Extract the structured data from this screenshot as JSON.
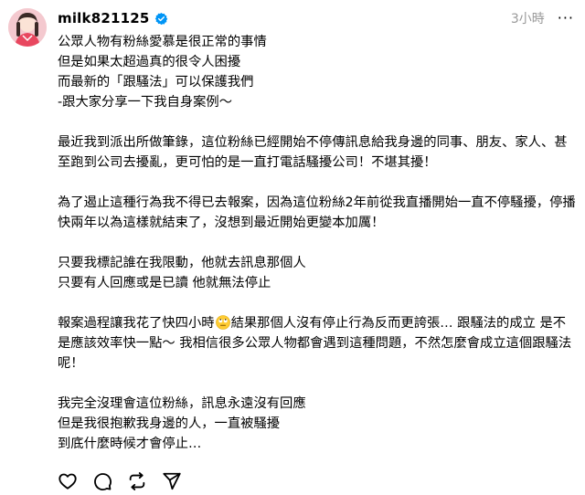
{
  "post": {
    "username": "milk821125",
    "timestamp": "3小時",
    "more_label": "···",
    "paragraphs": [
      [
        "公眾人物有粉絲愛慕是很正常的事情",
        "但是如果太超過真的很令人困擾",
        "而最新的「跟騷法」可以保護我們",
        "-跟大家分享一下我自身案例～"
      ],
      [
        "最近我到派出所做筆錄，這位粉絲已經開始不停傳訊息給我身邊的同事、朋友、家人、甚至跑到公司去擾亂，更可怕的是一直打電話騷擾公司！不堪其擾！"
      ],
      [
        "為了遏止這種行為我不得已去報案，因為這位粉絲2年前從我直播開始一直不停騷擾，停播快兩年以為這樣就結束了，沒想到最近開始更變本加厲！"
      ],
      [
        "只要我標記誰在我限動，他就去訊息那個人",
        "只要有人回應或是已讀 他就無法停止"
      ],
      [
        "報案過程讓我花了快四小時",
        "結果那個人沒有停止行為反而更誇張… 跟騷法的成立 是不是應該效率快一點～ 我相信很多公眾人物都會遇到這種問題，不然怎麼會成立這個跟騷法呢！"
      ],
      [
        "我完全沒理會這位粉絲，訊息永遠沒有回應",
        "但是我很抱歉我身邊的人，一直被騷擾",
        "到底什麼時候才會停止…"
      ]
    ]
  },
  "icons": {
    "avatar": "avatar-photo",
    "verified": "verified-badge-icon",
    "like": "heart-icon",
    "comment": "comment-icon",
    "repost": "repost-icon",
    "share": "send-icon",
    "emoji": "eye-roll-emoji"
  },
  "colors": {
    "verified": "#0095f6",
    "timestamp": "#999999",
    "text": "#000000"
  }
}
